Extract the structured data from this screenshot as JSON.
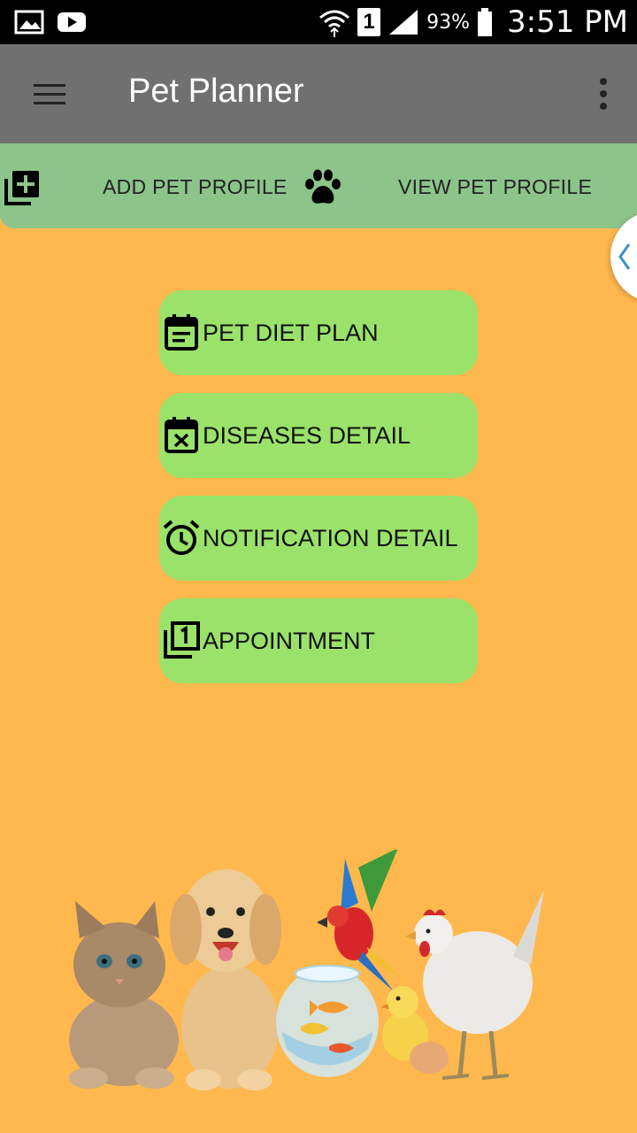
{
  "status_bar": {
    "battery_percent": "93%",
    "time": "3:51 PM",
    "sim_slot": "1",
    "icons": [
      "image-icon",
      "youtube-icon",
      "wifi-icon",
      "sim-icon",
      "signal-icon",
      "battery-icon"
    ]
  },
  "app_bar": {
    "title": "Pet Planner",
    "icons": [
      "hamburger-menu-icon",
      "overflow-menu-icon"
    ]
  },
  "profile_strip": {
    "add_label": "ADD PET PROFILE",
    "view_label": "VIEW PET PROFILE",
    "icons": [
      "add-to-queue-icon",
      "paw-icon"
    ]
  },
  "menu": {
    "items": [
      {
        "label": "PET DIET PLAN",
        "icon": "calendar-note-icon"
      },
      {
        "label": "DISEASES DETAIL",
        "icon": "calendar-x-icon"
      },
      {
        "label": "NOTIFICATION DETAIL",
        "icon": "alarm-clock-icon"
      },
      {
        "label": "APPOINTMENT",
        "icon": "filter-1-icon"
      }
    ]
  },
  "colors": {
    "background": "#FFB84D",
    "app_bar": "#707070",
    "profile_strip": "#8CC48A",
    "menu_button": "#9AE26A",
    "status_bar": "#000000"
  }
}
